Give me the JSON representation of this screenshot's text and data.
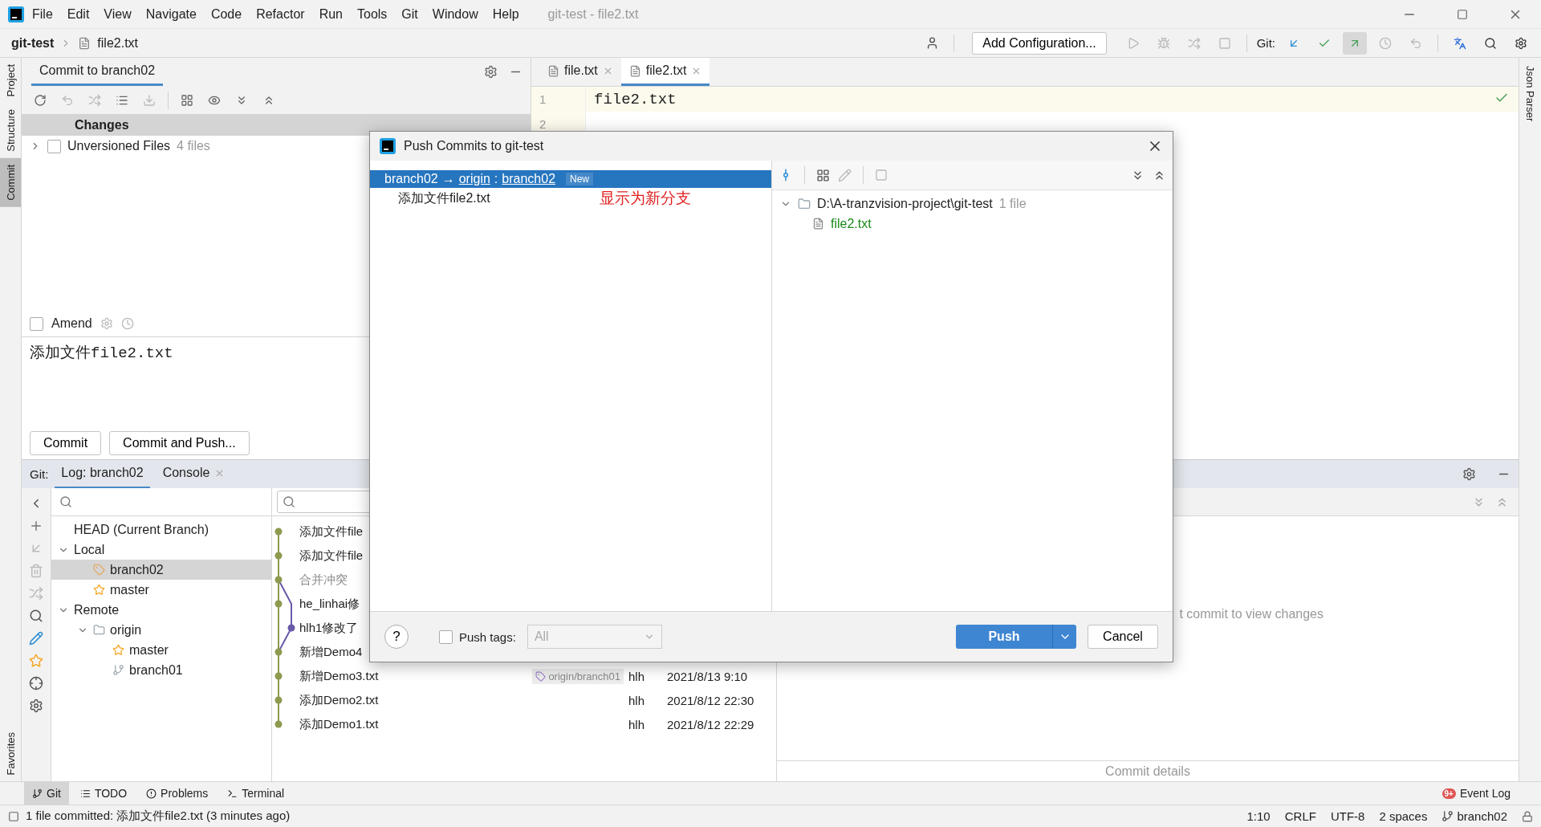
{
  "window": {
    "title": "git-test - file2.txt"
  },
  "menu": [
    "File",
    "Edit",
    "View",
    "Navigate",
    "Code",
    "Refactor",
    "Run",
    "Tools",
    "Git",
    "Window",
    "Help"
  ],
  "breadcrumb": [
    "git-test",
    "file2.txt"
  ],
  "toolbar": {
    "config_button": "Add Configuration...",
    "git_label": "Git:"
  },
  "left_strip": [
    {
      "label": "Project",
      "selected": false
    },
    {
      "label": "Structure",
      "selected": false
    },
    {
      "label": "Commit",
      "selected": true
    }
  ],
  "favorites": "Favorites",
  "right_strip": "Json Parser",
  "commit_panel": {
    "title": "Commit to branch02",
    "changes_header": "Changes",
    "tree": [
      {
        "label": "Unversioned Files",
        "count": "4 files",
        "checked": false,
        "expanded": false
      }
    ],
    "amend": {
      "label": "Amend",
      "checked": false
    },
    "message": "添加文件file2.txt",
    "buttons": [
      "Commit",
      "Commit and Push..."
    ]
  },
  "editor": {
    "tabs": [
      {
        "label": "file.txt",
        "selected": false
      },
      {
        "label": "file2.txt",
        "selected": true
      }
    ],
    "lines": [
      {
        "number": "1",
        "text": "file2.txt",
        "current": true
      },
      {
        "number": "2",
        "current": false
      }
    ]
  },
  "git_window": {
    "label": "Git:",
    "tabs": [
      {
        "label": "Log: branch02",
        "selected": true,
        "closable": false
      },
      {
        "label": "Console",
        "selected": false,
        "closable": true
      }
    ],
    "branches": [
      {
        "label": "HEAD (Current Branch)",
        "kind": "head"
      },
      {
        "label": "Local",
        "kind": "group",
        "expanded": true,
        "children": [
          {
            "label": "branch02",
            "kind": "tag",
            "selected": true
          },
          {
            "label": "master",
            "kind": "star",
            "selected": false
          }
        ]
      },
      {
        "label": "Remote",
        "kind": "group",
        "expanded": true,
        "children": [
          {
            "label": "origin",
            "kind": "folder",
            "expanded": true,
            "children": [
              {
                "label": "master",
                "kind": "star",
                "selected": false
              },
              {
                "label": "branch01",
                "kind": "branch",
                "selected": false
              }
            ]
          }
        ]
      }
    ],
    "commits": [
      {
        "message": "添加文件file",
        "muted": false
      },
      {
        "message": "添加文件file",
        "muted": false
      },
      {
        "message": "合并冲突",
        "muted": true
      },
      {
        "message": "he_linhai修",
        "muted": false
      },
      {
        "message": "hlh1修改了",
        "muted": false
      },
      {
        "message": "新增Demo4",
        "muted": false
      },
      {
        "message": "新增Demo3.txt",
        "muted": false,
        "ref": "origin/branch01",
        "author": "hlh",
        "date": "2021/8/13 9:10"
      },
      {
        "message": "添加Demo2.txt",
        "muted": false,
        "author": "hlh",
        "date": "2021/8/12 22:30"
      },
      {
        "message": "添加Demo1.txt",
        "muted": false,
        "author": "hlh",
        "date": "2021/8/12 22:29"
      }
    ],
    "changes_hint": "t commit to view changes",
    "details_hint": "Commit details"
  },
  "bottom_tools": [
    {
      "label": "Git",
      "selected": true
    },
    {
      "label": "TODO",
      "selected": false
    },
    {
      "label": "Problems",
      "selected": false
    },
    {
      "label": "Terminal",
      "selected": false
    }
  ],
  "event_log": {
    "label": "Event Log",
    "badge": "9+"
  },
  "status_bar": {
    "message": "1 file committed: 添加文件file2.txt (3 minutes ago)",
    "position": "1:10",
    "line_ending": "CRLF",
    "encoding": "UTF-8",
    "indent": "2 spaces",
    "branch": "branch02"
  },
  "dialog": {
    "title": "Push Commits to git-test",
    "push_spec": {
      "source": "branch02",
      "arrow": "→",
      "remote": "origin",
      "separator": ":",
      "target": "branch02",
      "badge": "New",
      "selected": true
    },
    "commits": [
      "添加文件file2.txt"
    ],
    "annotation": "显示为新分支",
    "files": {
      "path": "D:\\A-tranzvision-project\\git-test",
      "count": "1 file",
      "expanded": true,
      "children": [
        "file2.txt"
      ]
    },
    "help": "?",
    "push_tags": {
      "label": "Push tags:",
      "checked": false,
      "value": "All"
    },
    "buttons": {
      "push": "Push",
      "cancel": "Cancel"
    }
  }
}
